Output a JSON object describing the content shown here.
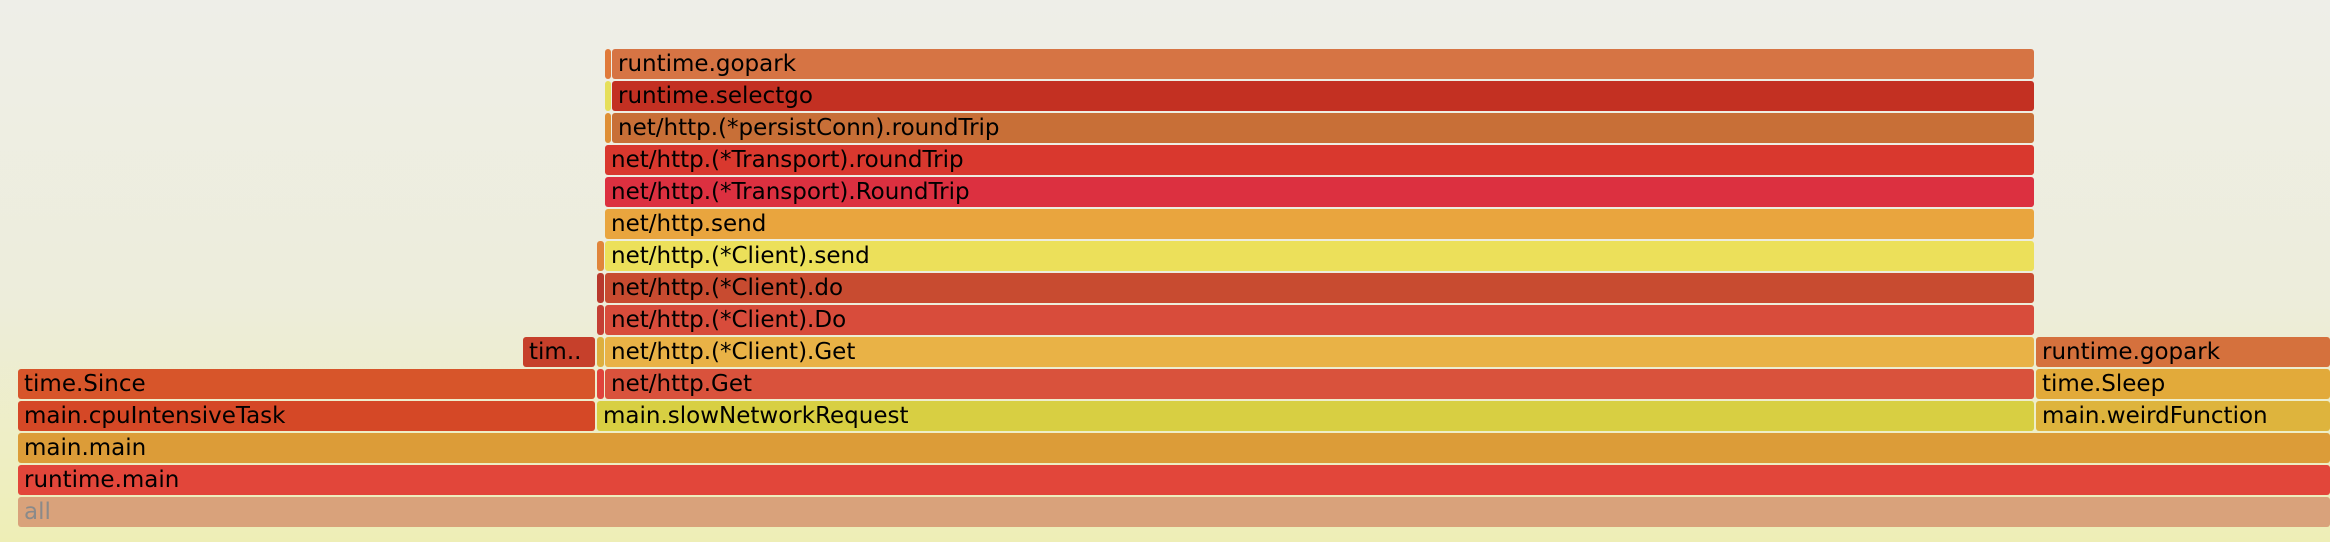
{
  "flamegraph": {
    "frames": [
      {
        "label": "all",
        "color": "#d9a27b",
        "muted": true
      },
      {
        "label": "runtime.main",
        "color": "#e2463a"
      },
      {
        "label": "main.main",
        "color": "#dc9c38"
      },
      {
        "label": "main.cpuIntensiveTask",
        "color": "#d54826"
      },
      {
        "label": "main.slowNetworkRequest",
        "color": "#d8cf42"
      },
      {
        "label": "main.weirdFunction",
        "color": "#deb43d"
      },
      {
        "label": "time.Since",
        "color": "#d7552a"
      },
      {
        "label": "",
        "color": "#e0443b"
      },
      {
        "label": "net/http.Get",
        "color": "#d9523c"
      },
      {
        "label": "time.Sleep",
        "color": "#e2aa3a"
      },
      {
        "label": "tim..",
        "color": "#c6402b"
      },
      {
        "label": "",
        "color": "#ddaf3e"
      },
      {
        "label": "net/http.(*Client).Get",
        "color": "#e9b246"
      },
      {
        "label": "runtime.gopark",
        "color": "#d5713d"
      },
      {
        "label": "",
        "color": "#c43f34"
      },
      {
        "label": "net/http.(*Client).Do",
        "color": "#d84c3b"
      },
      {
        "label": "",
        "color": "#b8392d"
      },
      {
        "label": "net/http.(*Client).do",
        "color": "#c84b30"
      },
      {
        "label": "",
        "color": "#e0853b"
      },
      {
        "label": "net/http.(*Client).send",
        "color": "#ece05a"
      },
      {
        "label": "net/http.send",
        "color": "#e9a53e"
      },
      {
        "label": "net/http.(*Transport).RoundTrip",
        "color": "#dc3040"
      },
      {
        "label": "net/http.(*Transport).roundTrip",
        "color": "#d9382e"
      },
      {
        "label": "",
        "color": "#df8f35"
      },
      {
        "label": "net/http.(*persistConn).roundTrip",
        "color": "#c86f37"
      },
      {
        "label": "",
        "color": "#e6df5a"
      },
      {
        "label": "runtime.selectgo",
        "color": "#c33022"
      },
      {
        "label": "",
        "color": "#e07a3a"
      },
      {
        "label": "runtime.gopark",
        "color": "#d67444"
      }
    ]
  }
}
